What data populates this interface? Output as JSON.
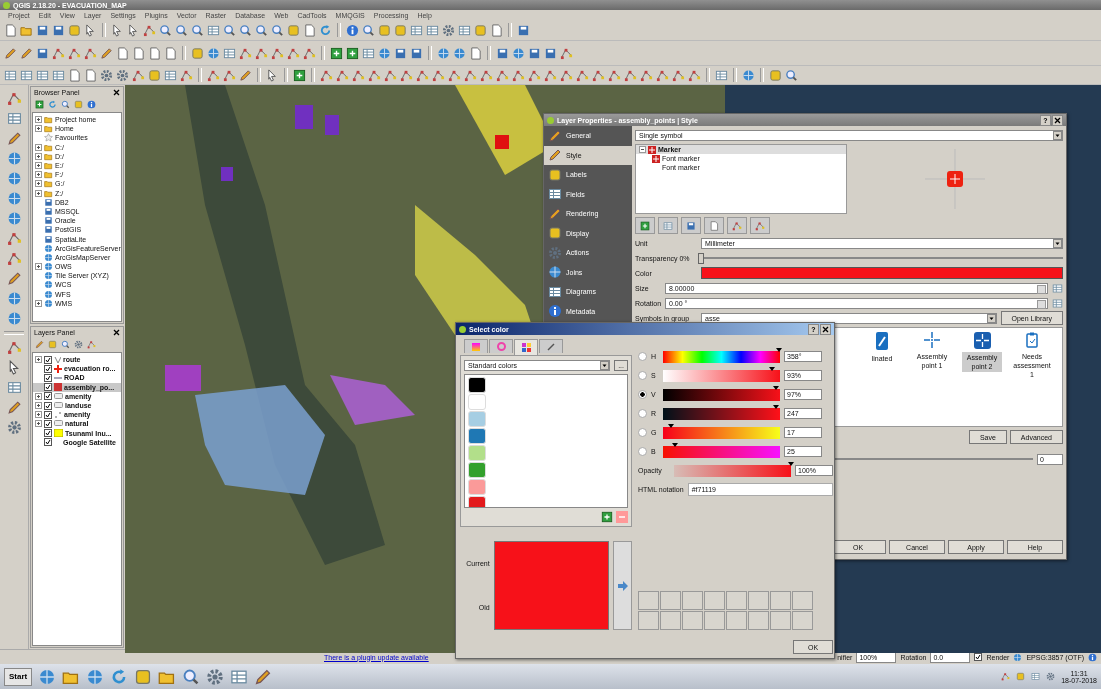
{
  "window": {
    "title": "QGIS 2.18.20 - EVACUATION_MAP"
  },
  "help_buttons": [
    "?",
    "?"
  ],
  "menu": [
    "Project",
    "Edit",
    "View",
    "Layer",
    "Settings",
    "Plugins",
    "Vector",
    "Raster",
    "Database",
    "Web",
    "CadTools",
    "MMQGIS",
    "Processing",
    "Help"
  ],
  "browser_panel": {
    "title": "Browser Panel",
    "items": [
      {
        "label": "Project home",
        "kind": "folder"
      },
      {
        "label": "Home",
        "kind": "folder"
      },
      {
        "label": "Favourites",
        "kind": "favourites"
      },
      {
        "label": "C:/",
        "kind": "folder"
      },
      {
        "label": "D:/",
        "kind": "folder"
      },
      {
        "label": "E:/",
        "kind": "folder"
      },
      {
        "label": "F:/",
        "kind": "folder"
      },
      {
        "label": "G:/",
        "kind": "folder"
      },
      {
        "label": "Z:/",
        "kind": "folder"
      },
      {
        "label": "DB2",
        "kind": "database"
      },
      {
        "label": "MSSQL",
        "kind": "database"
      },
      {
        "label": "Oracle",
        "kind": "database"
      },
      {
        "label": "PostGIS",
        "kind": "database"
      },
      {
        "label": "SpatiaLite",
        "kind": "database"
      },
      {
        "label": "ArcGisFeatureServer",
        "kind": "server"
      },
      {
        "label": "ArcGisMapServer",
        "kind": "server"
      },
      {
        "label": "OWS",
        "kind": "service"
      },
      {
        "label": "Tile Server (XYZ)",
        "kind": "server"
      },
      {
        "label": "WCS",
        "kind": "server"
      },
      {
        "label": "WFS",
        "kind": "server"
      },
      {
        "label": "WMS",
        "kind": "service"
      }
    ]
  },
  "layers_panel": {
    "title": "Layers Panel",
    "layers": [
      {
        "label": "route",
        "kind": "group",
        "checked": true,
        "selected": false
      },
      {
        "label": "evacuation ro...",
        "kind": "marker",
        "checked": true,
        "selected": false
      },
      {
        "label": "ROAD",
        "kind": "line",
        "checked": true,
        "selected": false
      },
      {
        "label": "assembly_po...",
        "kind": "symbol",
        "checked": true,
        "selected": true
      },
      {
        "label": "amenity",
        "kind": "polygon",
        "checked": true,
        "selected": false
      },
      {
        "label": "landuse",
        "kind": "polygon",
        "checked": true,
        "selected": false
      },
      {
        "label": "amenity",
        "kind": "point",
        "checked": true,
        "selected": false
      },
      {
        "label": "natural",
        "kind": "polygon",
        "checked": true,
        "selected": false
      },
      {
        "label": "Tsunami Inu...",
        "kind": "fill",
        "checked": true,
        "selected": false
      },
      {
        "label": "Google Satellite",
        "kind": "raster",
        "checked": true,
        "selected": false
      }
    ]
  },
  "layer_properties": {
    "title": "Layer Properties - assembly_points | Style",
    "sections": [
      {
        "label": "General",
        "kind": "tools",
        "selected": false
      },
      {
        "label": "Style",
        "kind": "brush",
        "selected": true
      },
      {
        "label": "Labels",
        "kind": "label",
        "selected": false
      },
      {
        "label": "Fields",
        "kind": "table",
        "selected": false
      },
      {
        "label": "Rendering",
        "kind": "brush",
        "selected": false
      },
      {
        "label": "Display",
        "kind": "bubble",
        "selected": false
      },
      {
        "label": "Actions",
        "kind": "gear",
        "selected": false
      },
      {
        "label": "Joins",
        "kind": "join",
        "selected": false
      },
      {
        "label": "Diagrams",
        "kind": "chart",
        "selected": false
      },
      {
        "label": "Metadata",
        "kind": "info",
        "selected": false
      }
    ],
    "renderer": "Single symbol",
    "symbol_tree": [
      {
        "label": "Marker",
        "kind": "marker",
        "children": [
          {
            "label": "Font marker",
            "kind": "marker"
          },
          {
            "label": "Font marker",
            "kind": "plain"
          }
        ]
      }
    ],
    "unit": {
      "label": "Unit",
      "value": "Millimeter"
    },
    "transparency": {
      "label": "Transparency 0%",
      "level": 0
    },
    "color": {
      "label": "Color",
      "color": "#f71119"
    },
    "size": {
      "label": "Size",
      "value": "8.00000"
    },
    "rotation": {
      "label": "Rotation",
      "value": "0.00 °"
    },
    "symbols_group": {
      "label": "Symbols in group",
      "value": "asse"
    },
    "open_library": "Open Library",
    "symbols": [
      {
        "label": "linated",
        "kind": "pen",
        "selected": false
      },
      {
        "label": "Assembly point 1",
        "kind": "cross",
        "selected": false
      },
      {
        "label": "Assembly point 2",
        "kind": "tile",
        "selected": true
      },
      {
        "label": "Needs assessment 1",
        "kind": "clipboard",
        "selected": false
      }
    ],
    "symbol_buttons": [
      "Save",
      "Advanced"
    ],
    "spin_value": "0",
    "buttons": [
      "OK",
      "Cancel",
      "Apply",
      "Help"
    ]
  },
  "select_color": {
    "title": "Select color",
    "tabs": [
      {
        "kind": "ramp",
        "selected": false
      },
      {
        "kind": "wheel",
        "selected": false
      },
      {
        "kind": "palette",
        "selected": true
      },
      {
        "kind": "picker",
        "selected": false
      }
    ],
    "palette": "Standard colors",
    "palette_menu": "...",
    "swatches": [
      {
        "color": "#000000"
      },
      {
        "color": "#ffffff"
      },
      {
        "color": "#a6cee3"
      },
      {
        "color": "#1f78b4"
      },
      {
        "color": "#b2df8a"
      },
      {
        "color": "#33a02c"
      },
      {
        "color": "#fb9a99"
      },
      {
        "color": "#e31a1c"
      }
    ],
    "channels": [
      {
        "label": "H",
        "kind": "hue",
        "value": "358°",
        "level": 0.99,
        "selected": false
      },
      {
        "label": "S",
        "kind": "sat",
        "value": "93%",
        "level": 0.93,
        "selected": false
      },
      {
        "label": "V",
        "kind": "val",
        "value": "97%",
        "level": 0.97,
        "selected": true
      },
      {
        "label": "R",
        "kind": "red",
        "value": "247",
        "level": 0.97,
        "selected": false
      },
      {
        "label": "G",
        "kind": "green",
        "value": "17",
        "level": 0.07,
        "selected": false
      },
      {
        "label": "B",
        "kind": "blue",
        "value": "25",
        "level": 0.1,
        "selected": false
      }
    ],
    "opacity": {
      "label": "Opacity",
      "value": "100%",
      "level": 1
    },
    "html": {
      "label": "HTML notation",
      "value": "#f71119"
    },
    "current": {
      "label": "Current",
      "color": "#f71119"
    },
    "old": {
      "label": "Old",
      "color": "#f71119"
    },
    "ok": "OK"
  },
  "status_bar": {
    "message": "There is a plugin update available",
    "magnifier_label": "nifier",
    "magnifier": "100%",
    "rotation_label": "Rotation",
    "rotation": "0.0",
    "render": {
      "label": "Render",
      "checked": true
    },
    "crs": "EPSG:3857 (OTF)"
  },
  "taskbar": {
    "start": "Start",
    "time": "11:31",
    "date": "18-07-2018"
  }
}
